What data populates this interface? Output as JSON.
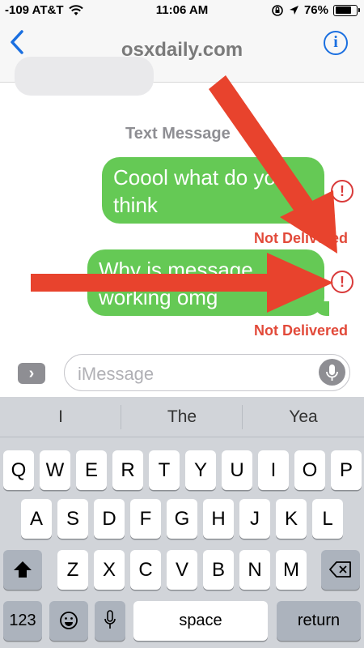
{
  "status_bar": {
    "carrier": "-109 AT&T",
    "time": "11:06 AM",
    "battery_percent": "76%",
    "battery_level": 0.76
  },
  "nav": {
    "title": "osxdaily.com"
  },
  "conversation": {
    "service_label": "Text Message",
    "messages": [
      {
        "text_line1": "Coool what do you",
        "text_line2": "think",
        "status": "Not Delivered"
      },
      {
        "text_line1": "Why is message",
        "text_line2": "working omg",
        "status": "Not Delivered"
      }
    ]
  },
  "composer": {
    "placeholder": "iMessage",
    "apps_glyph": "›"
  },
  "keyboard": {
    "suggestions": [
      "I",
      "The",
      "Yea"
    ],
    "row1": [
      "Q",
      "W",
      "E",
      "R",
      "T",
      "Y",
      "U",
      "I",
      "O",
      "P"
    ],
    "row2": [
      "A",
      "S",
      "D",
      "F",
      "G",
      "H",
      "J",
      "K",
      "L"
    ],
    "row3": [
      "Z",
      "X",
      "C",
      "V",
      "B",
      "N",
      "M"
    ],
    "numbers_key": "123",
    "space_key": "space",
    "return_key": "return"
  },
  "colors": {
    "bubble_green": "#65c955",
    "error_red": "#d93a3a",
    "link_blue": "#1a6fe0",
    "annotation_arrow": "#e8432d"
  },
  "icons": [
    "wifi-icon",
    "lock-rotation-icon",
    "location-arrow-icon",
    "battery-icon",
    "back-chevron-icon",
    "info-icon",
    "error-icon",
    "apps-chevron-icon",
    "microphone-icon",
    "shift-icon",
    "backspace-icon",
    "emoji-icon",
    "dictation-icon"
  ]
}
